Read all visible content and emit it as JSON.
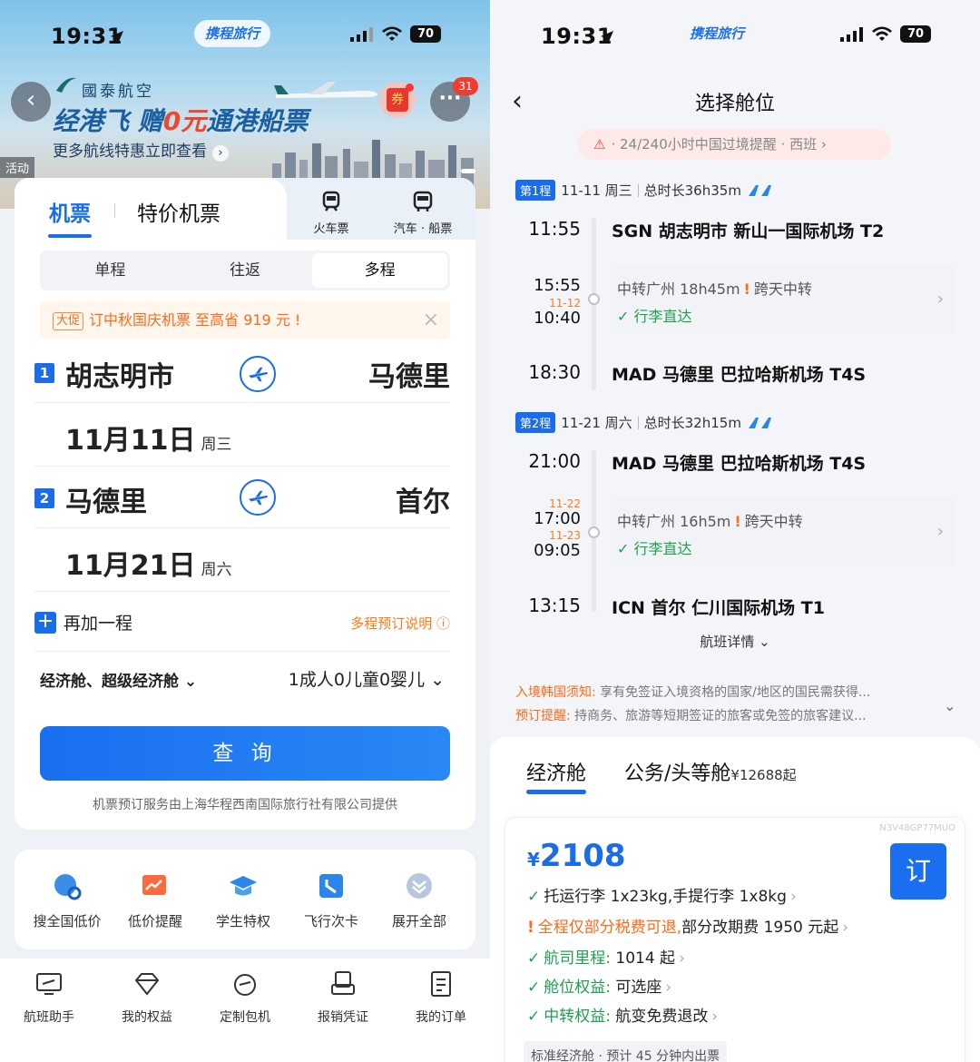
{
  "left": {
    "status": {
      "time": "19:31",
      "brand": "携程旅行",
      "battery": "70"
    },
    "banner": {
      "airline": "國泰航空",
      "title_a": "经港飞 赠",
      "title_b": "0元",
      "title_c": "通港船票",
      "subtitle": "更多航线特惠立即查看",
      "activity_tag": "活动",
      "coupon_label": "券",
      "message_badge": "31"
    },
    "tabs": {
      "flights": "机票",
      "special": "特价机票",
      "train": "火车票",
      "bus_ship": "汽车 · 船票"
    },
    "trip_types": [
      {
        "label": "单程"
      },
      {
        "label": "往返"
      },
      {
        "label": "多程"
      }
    ],
    "promo": {
      "tag": "大促",
      "text": "订中秋国庆机票 至高省 919 元 !"
    },
    "segments": [
      {
        "num": "1",
        "from": "胡志明市",
        "to": "马德里",
        "date": "11月11日",
        "weekday": "周三"
      },
      {
        "num": "2",
        "from": "马德里",
        "to": "首尔",
        "date": "11月21日",
        "weekday": "周六"
      }
    ],
    "add_segment": "再加一程",
    "multi_explain": "多程预订说明",
    "cabin": "经济舱、超级经济舱",
    "passengers": "1成人0儿童0婴儿",
    "search_button": "查 询",
    "provider": "机票预订服务由上海华程西南国际旅行社有限公司提供",
    "quick": [
      {
        "label": "搜全国低价"
      },
      {
        "label": "低价提醒"
      },
      {
        "label": "学生特权"
      },
      {
        "label": "飞行次卡"
      },
      {
        "label": "展开全部"
      }
    ],
    "nav": [
      {
        "label": "航班助手"
      },
      {
        "label": "我的权益"
      },
      {
        "label": "定制包机"
      },
      {
        "label": "报销凭证"
      },
      {
        "label": "我的订单"
      }
    ]
  },
  "right": {
    "status": {
      "time": "19:31",
      "brand": "携程旅行",
      "battery": "70"
    },
    "title": "选择舱位",
    "transit_notice": "· 24/240小时中国过境提醒 · 西班",
    "legs": [
      {
        "tag": "第1程",
        "date": "11-11 周三",
        "duration": "总时长36h35m",
        "dep_time": "11:55",
        "dep_airport": "SGN  胡志明市 新山一国际机场 T2",
        "arr1_time": "15:55",
        "dep2_date": "11-12",
        "dep2_time": "10:40",
        "transfer": "中转广州 18h45m",
        "transfer_warn": "跨天中转",
        "baggage": "行李直达",
        "arr_time": "18:30",
        "arr_airport": "MAD  马德里 巴拉哈斯机场 T4S"
      },
      {
        "tag": "第2程",
        "date": "11-21 周六",
        "duration": "总时长32h15m",
        "dep_time": "21:00",
        "dep_airport": "MAD  马德里 巴拉哈斯机场 T4S",
        "arr1_date": "11-22",
        "arr1_time": "17:00",
        "dep2_date": "11-23",
        "dep2_time": "09:05",
        "transfer": "中转广州 16h5m",
        "transfer_warn": "跨天中转",
        "baggage": "行李直达",
        "arr_time": "13:15",
        "arr_airport": "ICN  首尔 仁川国际机场 T1"
      }
    ],
    "flight_details": "航班详情",
    "notices": [
      {
        "label": "入境韩国须知:",
        "text": "享有免签证入境资格的国家/地区的国民需获得..."
      },
      {
        "label": "预订提醒:",
        "text": "持商务、旅游等短期签证的旅客或免签的旅客建议..."
      }
    ],
    "cabin_tabs": {
      "economy": "经济舱",
      "business": "公务/头等舱",
      "business_price": "¥12688起"
    },
    "fare": {
      "code": "N3V48GP77MUO",
      "currency": "¥",
      "price": "2108",
      "book": "订",
      "perks": [
        {
          "mark": "✓",
          "label": "",
          "text": "托运行李 1x23kg,手提行李 1x8kg"
        },
        {
          "mark": "!",
          "label": "全程仅部分税费可退,",
          "text": "部分改期费 1950 元起"
        },
        {
          "mark": "✓",
          "label": "航司里程:",
          "text": " 1014 起"
        },
        {
          "mark": "✓",
          "label": "舱位权益:",
          "text": " 可选座"
        },
        {
          "mark": "✓",
          "label": "中转权益:",
          "text": " 航变免费退改"
        }
      ],
      "footer": "标准经济舱 · 预计 45 分钟内出票"
    }
  }
}
